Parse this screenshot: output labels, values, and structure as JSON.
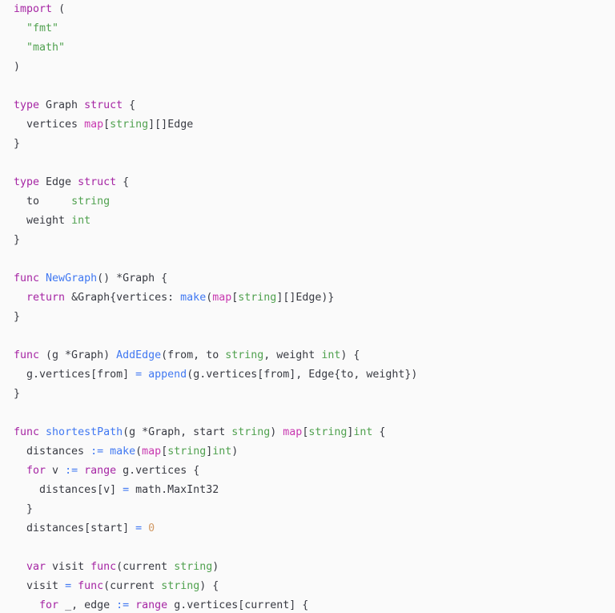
{
  "editor": {
    "language": "go",
    "background_color": "#fafafa",
    "default_text_color": "#383a42",
    "font_size_px": 13.3,
    "line_height_px": 24,
    "theme_colors": {
      "keyword": "#a626a4",
      "string": "#50a14f",
      "builtin_type": "#50a14f",
      "function": "#4078f2",
      "operator": "#4078f2",
      "map_builtin": "#c838b0",
      "number": "#d19a66",
      "identifier": "#383a42"
    }
  },
  "code": {
    "lines": [
      {
        "indent": 0,
        "tokens": [
          {
            "t": "import",
            "c": "kw"
          },
          {
            "t": " ",
            "c": "plain"
          },
          {
            "t": "(",
            "c": "punct"
          }
        ]
      },
      {
        "indent": 1,
        "tokens": [
          {
            "t": "\"fmt\"",
            "c": "str"
          }
        ]
      },
      {
        "indent": 1,
        "tokens": [
          {
            "t": "\"math\"",
            "c": "str"
          }
        ]
      },
      {
        "indent": 0,
        "tokens": [
          {
            "t": ")",
            "c": "punct"
          }
        ]
      },
      {
        "indent": 0,
        "tokens": []
      },
      {
        "indent": 0,
        "tokens": [
          {
            "t": "type",
            "c": "kw"
          },
          {
            "t": " Graph ",
            "c": "plain"
          },
          {
            "t": "struct",
            "c": "kw"
          },
          {
            "t": " {",
            "c": "punct"
          }
        ]
      },
      {
        "indent": 1,
        "tokens": [
          {
            "t": "vertices ",
            "c": "plain"
          },
          {
            "t": "map",
            "c": "map"
          },
          {
            "t": "[",
            "c": "punct"
          },
          {
            "t": "string",
            "c": "type"
          },
          {
            "t": "][]Edge",
            "c": "punct"
          }
        ]
      },
      {
        "indent": 0,
        "tokens": [
          {
            "t": "}",
            "c": "punct"
          }
        ]
      },
      {
        "indent": 0,
        "tokens": []
      },
      {
        "indent": 0,
        "tokens": [
          {
            "t": "type",
            "c": "kw"
          },
          {
            "t": " Edge ",
            "c": "plain"
          },
          {
            "t": "struct",
            "c": "kw"
          },
          {
            "t": " {",
            "c": "punct"
          }
        ]
      },
      {
        "indent": 1,
        "tokens": [
          {
            "t": "to     ",
            "c": "plain"
          },
          {
            "t": "string",
            "c": "type"
          }
        ]
      },
      {
        "indent": 1,
        "tokens": [
          {
            "t": "weight ",
            "c": "plain"
          },
          {
            "t": "int",
            "c": "type"
          }
        ]
      },
      {
        "indent": 0,
        "tokens": [
          {
            "t": "}",
            "c": "punct"
          }
        ]
      },
      {
        "indent": 0,
        "tokens": []
      },
      {
        "indent": 0,
        "tokens": [
          {
            "t": "func",
            "c": "kw"
          },
          {
            "t": " ",
            "c": "plain"
          },
          {
            "t": "NewGraph",
            "c": "fn"
          },
          {
            "t": "() *Graph {",
            "c": "punct"
          }
        ]
      },
      {
        "indent": 1,
        "tokens": [
          {
            "t": "return",
            "c": "kw"
          },
          {
            "t": " &Graph{vertices: ",
            "c": "plain"
          },
          {
            "t": "make",
            "c": "fn"
          },
          {
            "t": "(",
            "c": "punct"
          },
          {
            "t": "map",
            "c": "map"
          },
          {
            "t": "[",
            "c": "punct"
          },
          {
            "t": "string",
            "c": "type"
          },
          {
            "t": "][]Edge)}",
            "c": "punct"
          }
        ]
      },
      {
        "indent": 0,
        "tokens": [
          {
            "t": "}",
            "c": "punct"
          }
        ]
      },
      {
        "indent": 0,
        "tokens": []
      },
      {
        "indent": 0,
        "tokens": [
          {
            "t": "func",
            "c": "kw"
          },
          {
            "t": " (g *Graph) ",
            "c": "plain"
          },
          {
            "t": "AddEdge",
            "c": "fn"
          },
          {
            "t": "(from, to ",
            "c": "plain"
          },
          {
            "t": "string",
            "c": "type"
          },
          {
            "t": ", weight ",
            "c": "plain"
          },
          {
            "t": "int",
            "c": "type"
          },
          {
            "t": ") {",
            "c": "punct"
          }
        ]
      },
      {
        "indent": 1,
        "tokens": [
          {
            "t": "g.vertices[from] ",
            "c": "plain"
          },
          {
            "t": "=",
            "c": "op"
          },
          {
            "t": " ",
            "c": "plain"
          },
          {
            "t": "append",
            "c": "fn"
          },
          {
            "t": "(g.vertices[from], Edge{to, weight})",
            "c": "plain"
          }
        ]
      },
      {
        "indent": 0,
        "tokens": [
          {
            "t": "}",
            "c": "punct"
          }
        ]
      },
      {
        "indent": 0,
        "tokens": []
      },
      {
        "indent": 0,
        "tokens": [
          {
            "t": "func",
            "c": "kw"
          },
          {
            "t": " ",
            "c": "plain"
          },
          {
            "t": "shortestPath",
            "c": "fn"
          },
          {
            "t": "(g *Graph, start ",
            "c": "plain"
          },
          {
            "t": "string",
            "c": "type"
          },
          {
            "t": ") ",
            "c": "plain"
          },
          {
            "t": "map",
            "c": "map"
          },
          {
            "t": "[",
            "c": "punct"
          },
          {
            "t": "string",
            "c": "type"
          },
          {
            "t": "]",
            "c": "punct"
          },
          {
            "t": "int",
            "c": "type"
          },
          {
            "t": " {",
            "c": "punct"
          }
        ]
      },
      {
        "indent": 1,
        "tokens": [
          {
            "t": "distances ",
            "c": "plain"
          },
          {
            "t": ":=",
            "c": "op"
          },
          {
            "t": " ",
            "c": "plain"
          },
          {
            "t": "make",
            "c": "fn"
          },
          {
            "t": "(",
            "c": "punct"
          },
          {
            "t": "map",
            "c": "map"
          },
          {
            "t": "[",
            "c": "punct"
          },
          {
            "t": "string",
            "c": "type"
          },
          {
            "t": "]",
            "c": "punct"
          },
          {
            "t": "int",
            "c": "type"
          },
          {
            "t": ")",
            "c": "punct"
          }
        ]
      },
      {
        "indent": 1,
        "tokens": [
          {
            "t": "for",
            "c": "kw"
          },
          {
            "t": " v ",
            "c": "plain"
          },
          {
            "t": ":=",
            "c": "op"
          },
          {
            "t": " ",
            "c": "plain"
          },
          {
            "t": "range",
            "c": "kw"
          },
          {
            "t": " g.vertices {",
            "c": "plain"
          }
        ]
      },
      {
        "indent": 2,
        "tokens": [
          {
            "t": "distances[v] ",
            "c": "plain"
          },
          {
            "t": "=",
            "c": "op"
          },
          {
            "t": " math.MaxInt32",
            "c": "plain"
          }
        ]
      },
      {
        "indent": 1,
        "tokens": [
          {
            "t": "}",
            "c": "punct"
          }
        ]
      },
      {
        "indent": 1,
        "tokens": [
          {
            "t": "distances[start] ",
            "c": "plain"
          },
          {
            "t": "=",
            "c": "op"
          },
          {
            "t": " ",
            "c": "plain"
          },
          {
            "t": "0",
            "c": "num"
          }
        ]
      },
      {
        "indent": 0,
        "tokens": []
      },
      {
        "indent": 1,
        "tokens": [
          {
            "t": "var",
            "c": "kw"
          },
          {
            "t": " visit ",
            "c": "plain"
          },
          {
            "t": "func",
            "c": "kw"
          },
          {
            "t": "(current ",
            "c": "plain"
          },
          {
            "t": "string",
            "c": "type"
          },
          {
            "t": ")",
            "c": "punct"
          }
        ]
      },
      {
        "indent": 1,
        "tokens": [
          {
            "t": "visit ",
            "c": "plain"
          },
          {
            "t": "=",
            "c": "op"
          },
          {
            "t": " ",
            "c": "plain"
          },
          {
            "t": "func",
            "c": "kw"
          },
          {
            "t": "(current ",
            "c": "plain"
          },
          {
            "t": "string",
            "c": "type"
          },
          {
            "t": ") {",
            "c": "punct"
          }
        ]
      },
      {
        "indent": 2,
        "tokens": [
          {
            "t": "for",
            "c": "kw"
          },
          {
            "t": " _, edge ",
            "c": "plain"
          },
          {
            "t": ":=",
            "c": "op"
          },
          {
            "t": " ",
            "c": "plain"
          },
          {
            "t": "range",
            "c": "kw"
          },
          {
            "t": " g.vertices[current] {",
            "c": "plain"
          }
        ]
      }
    ]
  }
}
